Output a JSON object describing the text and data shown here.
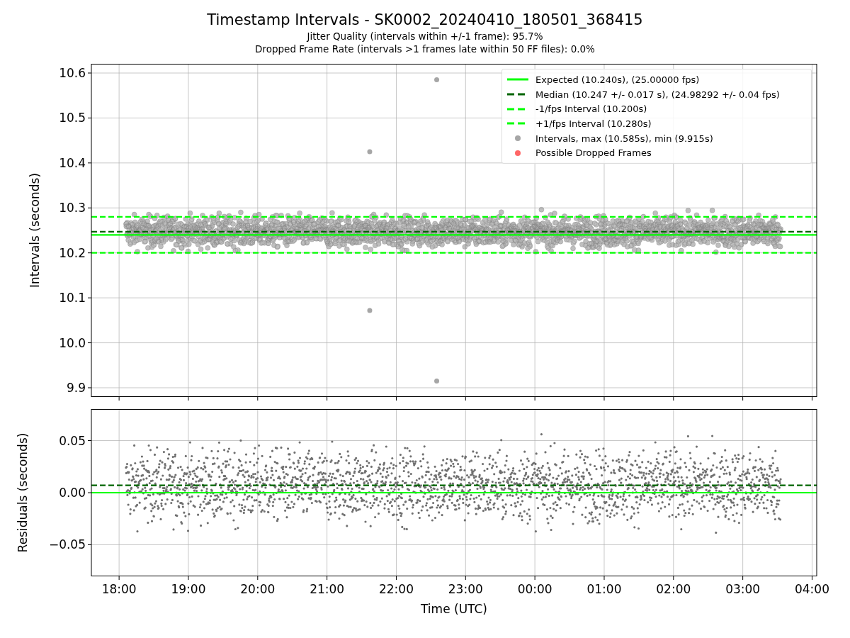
{
  "title": "Timestamp Intervals - SK0002_20240410_180501_368415",
  "subtitles": [
    "Jitter Quality (intervals within +/-1 frame): 95.7%",
    "Dropped Frame Rate (intervals >1 frames late within 50 FF files): 0.0%"
  ],
  "top_chart": {
    "chart_data": {
      "type": "line",
      "ylabel": "Intervals (seconds)",
      "grid": true,
      "x": [
        "2024-04-10 17:36",
        "2024-04-11 04:04"
      ],
      "xlim": [
        "2024-04-10 17:36",
        "2024-04-11 04:04"
      ],
      "ylim": [
        9.8795,
        10.6205
      ],
      "yticks": [
        {
          "value": 9.9,
          "label": "9.9"
        },
        {
          "value": 10.0,
          "label": "10.0"
        },
        {
          "value": 10.1,
          "label": "10.1"
        },
        {
          "value": 10.2,
          "label": "10.2"
        },
        {
          "value": 10.3,
          "label": "10.3"
        },
        {
          "value": 10.4,
          "label": "10.4"
        },
        {
          "value": 10.5,
          "label": "10.5"
        },
        {
          "value": 10.6,
          "label": "10.6"
        }
      ],
      "series": [
        {
          "name": "Expected (10.240s), (25.00000 fps)",
          "color": "#00ff00",
          "line_style": "solid",
          "values": [
            10.24,
            10.24
          ]
        },
        {
          "name": "Median (10.247 +/- 0.017 s), (24.98292 +/- 0.04 fps)",
          "color": "#006400",
          "line_style": "dashed",
          "values": [
            10.247,
            10.247
          ]
        },
        {
          "name": "-1/fps Interval (10.200s)",
          "color": "#00ff00",
          "line_style": "dashed",
          "values": [
            10.2,
            10.2
          ]
        },
        {
          "name": "+1/fps Interval (10.280s)",
          "color": "#00ff00",
          "line_style": "dashed",
          "values": [
            10.28,
            10.28
          ]
        },
        {
          "name": "Intervals, max (10.585s), min (9.915s)",
          "type": "scatter",
          "color": "#a6a6a6",
          "x": [
            "2024-04-10 22:35",
            "2024-04-10 21:37",
            "2024-04-10 21:37",
            "2024-04-10 22:35"
          ],
          "values": [
            10.585,
            10.425,
            10.072,
            9.915
          ]
        }
      ]
    }
  },
  "legend_points": [
    {
      "label": "Possible Dropped Frames",
      "color": "#ff6666"
    }
  ],
  "bottom_chart": {
    "chart_data": {
      "type": "line",
      "xlabel": "Time (UTC)",
      "ylabel": "Residuals (seconds)",
      "grid": true,
      "x": [
        "2024-04-10 17:36",
        "2024-04-11 04:04"
      ],
      "xlim": [
        "2024-04-10 17:36",
        "2024-04-11 04:04"
      ],
      "ylim": [
        -0.0803,
        0.0803
      ],
      "xticks": [
        {
          "value": "2024-04-10 18:00",
          "label": "18:00"
        },
        {
          "value": "2024-04-10 19:00",
          "label": "19:00"
        },
        {
          "value": "2024-04-10 20:00",
          "label": "20:00"
        },
        {
          "value": "2024-04-10 21:00",
          "label": "21:00"
        },
        {
          "value": "2024-04-10 22:00",
          "label": "22:00"
        },
        {
          "value": "2024-04-10 23:00",
          "label": "23:00"
        },
        {
          "value": "2024-04-11 00:00",
          "label": "00:00"
        },
        {
          "value": "2024-04-11 01:00",
          "label": "01:00"
        },
        {
          "value": "2024-04-11 02:00",
          "label": "02:00"
        },
        {
          "value": "2024-04-11 03:00",
          "label": "03:00"
        },
        {
          "value": "2024-04-11 04:00",
          "label": "04:00"
        }
      ],
      "yticks": [
        {
          "value": -0.05,
          "label": "−0.05"
        },
        {
          "value": 0,
          "label": "0.00"
        },
        {
          "value": 0.05,
          "label": "0.05"
        }
      ],
      "series": [
        {
          "color": "#00ff00",
          "line_style": "solid",
          "values": [
            0,
            0
          ]
        },
        {
          "color": "#006400",
          "line_style": "dashed",
          "values": [
            0.007,
            0.007
          ]
        }
      ]
    }
  }
}
